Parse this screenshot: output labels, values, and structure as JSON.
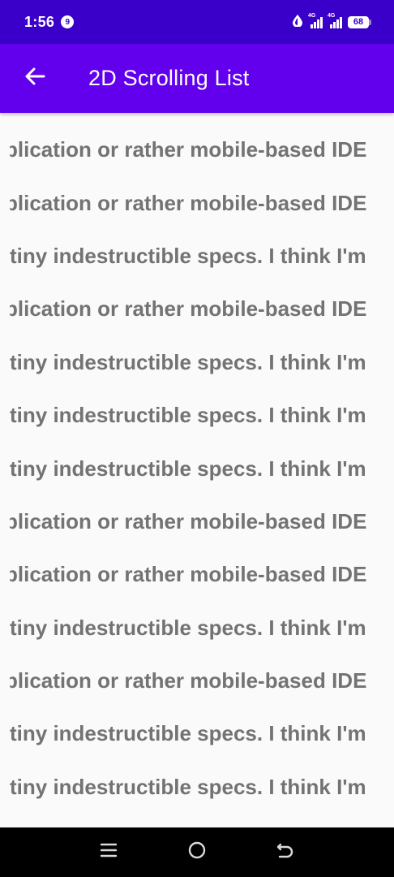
{
  "status_bar": {
    "time": "1:56",
    "notification_count": "9",
    "signal_label_1": "4G",
    "signal_label_2": "4G",
    "battery_level": "68"
  },
  "app_bar": {
    "back_icon": "arrow-left-icon",
    "title": "2D Scrolling List",
    "background_color": "#6200ee"
  },
  "list": {
    "text_color": "#737373",
    "rows": [
      "plication or rather mobile-based IDE",
      "plication or rather mobile-based IDE",
      "tiny indestructible specs. I think I'm",
      "plication or rather mobile-based IDE",
      "tiny indestructible specs. I think I'm",
      "tiny indestructible specs. I think I'm",
      "tiny indestructible specs. I think I'm",
      "plication or rather mobile-based IDE",
      "plication or rather mobile-based IDE",
      "tiny indestructible specs. I think I'm",
      "plication or rather mobile-based IDE",
      "tiny indestructible specs. I think I'm",
      "tiny indestructible specs. I think I'm"
    ]
  },
  "nav_bar": {
    "menu_icon": "menu-icon",
    "home_icon": "home-circle-icon",
    "back_icon": "back-return-icon"
  }
}
